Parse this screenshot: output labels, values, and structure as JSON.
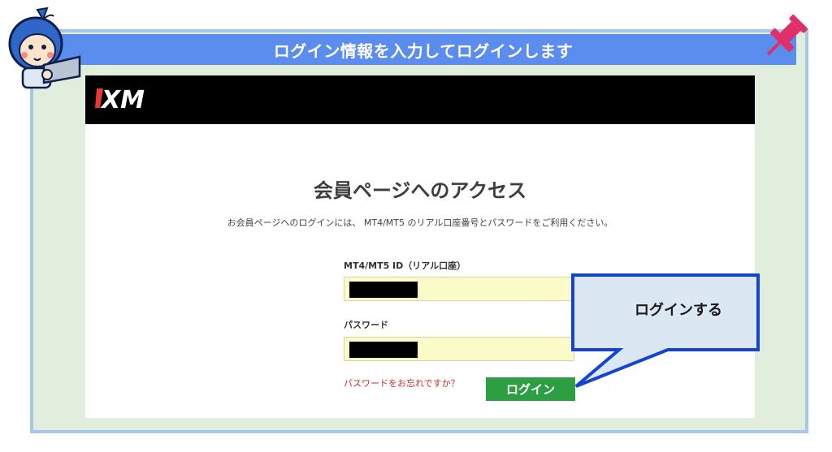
{
  "banner": {
    "text": "ログイン情報を入力してログインします"
  },
  "xm": {
    "logo_text": "XM"
  },
  "login": {
    "title": "会員ページへのアクセス",
    "description": "お会員ページへのログインには、 MT4/MT5 のリアル口座番号とパスワードをご利用ください。",
    "id_label": "MT4/MT5 ID（リアル口座）",
    "password_label": "パスワード",
    "forgot_link": "パスワードをお忘れですか？",
    "login_button": "ログイン"
  },
  "callout": {
    "text": "ログインする"
  },
  "colors": {
    "banner": "#5b8def",
    "frame_bg": "#e2eedd",
    "frame_border": "#a7c7e7",
    "login_button": "#2e9e43",
    "input_bg": "#fbfbc9",
    "forgot_link": "#d22a2a",
    "callout_border": "#1444d6",
    "callout_bg": "#dce7f4",
    "pin": "#e0306a"
  },
  "icons": {
    "mascot": "mascot-icon",
    "pin": "pushpin-icon",
    "logo": "xm-logo-icon"
  }
}
